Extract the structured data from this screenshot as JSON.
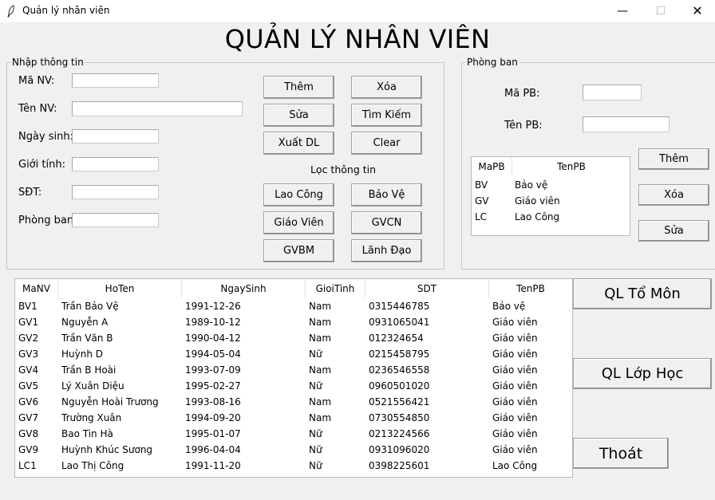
{
  "window": {
    "title": "Quản lý nhân viên",
    "minimize": "—",
    "maximize": "☐",
    "close": "✕"
  },
  "app_title": "QUẢN LÝ NHÂN VIÊN",
  "input_group": {
    "legend": "Nhập thông tin",
    "fields": [
      {
        "label": "Mã NV:",
        "value": ""
      },
      {
        "label": "Tên NV:",
        "value": ""
      },
      {
        "label": "Ngày sinh:",
        "value": ""
      },
      {
        "label": "Giới tính:",
        "value": ""
      },
      {
        "label": "SĐT:",
        "value": ""
      },
      {
        "label": "Phòng ban:",
        "value": ""
      }
    ],
    "buttons": {
      "add": "Thêm",
      "delete": "Xóa",
      "edit": "Sửa",
      "search": "Tìm Kiếm",
      "export": "Xuất DL",
      "clear": "Clear"
    },
    "filter_label": "Lọc thông tin",
    "filter_buttons": {
      "lao_cong": "Lao Công",
      "bao_ve": "Bảo Vệ",
      "giao_vien": "Giáo Viên",
      "gvcn": "GVCN",
      "gvbm": "GVBM",
      "lanh_dao": "Lãnh Đạo"
    }
  },
  "dept_group": {
    "legend": "Phòng ban",
    "fields": [
      {
        "label": "Mã PB:",
        "value": ""
      },
      {
        "label": "Tên PB:",
        "value": ""
      }
    ],
    "table": {
      "columns": [
        "MaPB",
        "TenPB"
      ],
      "rows": [
        [
          "BV",
          "Bảo vệ"
        ],
        [
          "GV",
          "Giáo viên"
        ],
        [
          "LC",
          "Lao Công"
        ]
      ]
    },
    "buttons": {
      "add": "Thêm",
      "delete": "Xóa",
      "edit": "Sửa"
    }
  },
  "employee_table": {
    "columns": [
      "MaNV",
      "HoTen",
      "NgaySinh",
      "GioiTinh",
      "SDT",
      "TenPB"
    ],
    "rows": [
      [
        "BV1",
        "Trần Bảo Vệ",
        "1991-12-26",
        "Nam",
        "0315446785",
        "Bảo vệ"
      ],
      [
        "GV1",
        "Nguyễn A",
        "1989-10-12",
        "Nam",
        "0931065041",
        "Giáo viên"
      ],
      [
        "GV2",
        "Trần Văn B",
        "1990-04-12",
        "Nam",
        "012324654",
        "Giáo viên"
      ],
      [
        "GV3",
        "Huỳnh D",
        "1994-05-04",
        "Nữ",
        "0215458795",
        "Giáo viên"
      ],
      [
        "GV4",
        "Trần B Hoài",
        "1993-07-09",
        "Nam",
        "0236546558",
        "Giáo viên"
      ],
      [
        "GV5",
        "Lý Xuân Diệu",
        "1995-02-27",
        "Nữ",
        "0960501020",
        "Giáo viên"
      ],
      [
        "GV6",
        "Nguyễn Hoài Trương",
        "1993-08-16",
        "Nam",
        "0521556421",
        "Giáo viên"
      ],
      [
        "GV7",
        "Trường Xuân",
        "1994-09-20",
        "Nam",
        "0730554850",
        "Giáo viên"
      ],
      [
        "GV8",
        "Bao Tin Hà",
        "1995-01-07",
        "Nữ",
        "0213224566",
        "Giáo viên"
      ],
      [
        "GV9",
        "Huỳnh Khúc Sương",
        "1996-04-04",
        "Nữ",
        "0931096020",
        "Giáo viên"
      ],
      [
        "LC1",
        "Lao Thị Công",
        "1991-11-20",
        "Nữ",
        "0398225601",
        "Lao Công"
      ]
    ]
  },
  "side_buttons": {
    "to_mon": "QL Tổ Môn",
    "lop_hoc": "QL Lớp Học",
    "exit": "Thoát"
  }
}
